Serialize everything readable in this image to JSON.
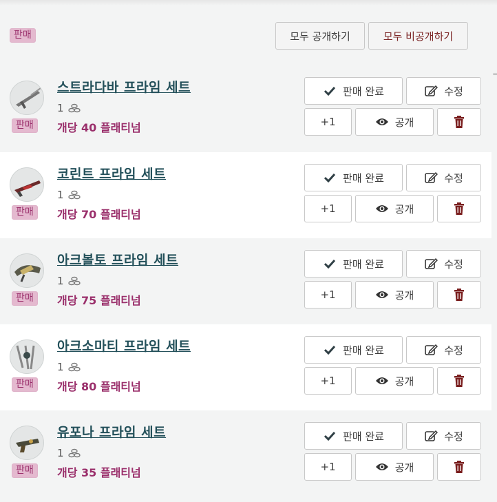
{
  "header": {
    "sell_badge": "판매",
    "make_all_public": "모두 공개하기",
    "make_all_private": "모두 비공개하기",
    "cut_text": "ㄱ"
  },
  "labels": {
    "sold": "판매 완료",
    "edit": "수정",
    "plus_one": "+1",
    "public": "공개",
    "sell": "판매"
  },
  "items": [
    {
      "name": "스트라다바 프라임 세트",
      "quantity": "1",
      "price": "개당 40 플래티넘",
      "icon": "rifle-icon"
    },
    {
      "name": "코린트 프라임 세트",
      "quantity": "1",
      "price": "개당 70 플래티넘",
      "icon": "shotgun-icon"
    },
    {
      "name": "아크볼토 프라임 세트",
      "quantity": "1",
      "price": "개당 75 플래티넘",
      "icon": "archgun-icon"
    },
    {
      "name": "아크소마티 프라임 세트",
      "quantity": "1",
      "price": "개당 80 플래티넘",
      "icon": "blades-icon"
    },
    {
      "name": "유포나 프라임 세트",
      "quantity": "1",
      "price": "개당 35 플래티넘",
      "icon": "pistol-icon"
    }
  ]
}
